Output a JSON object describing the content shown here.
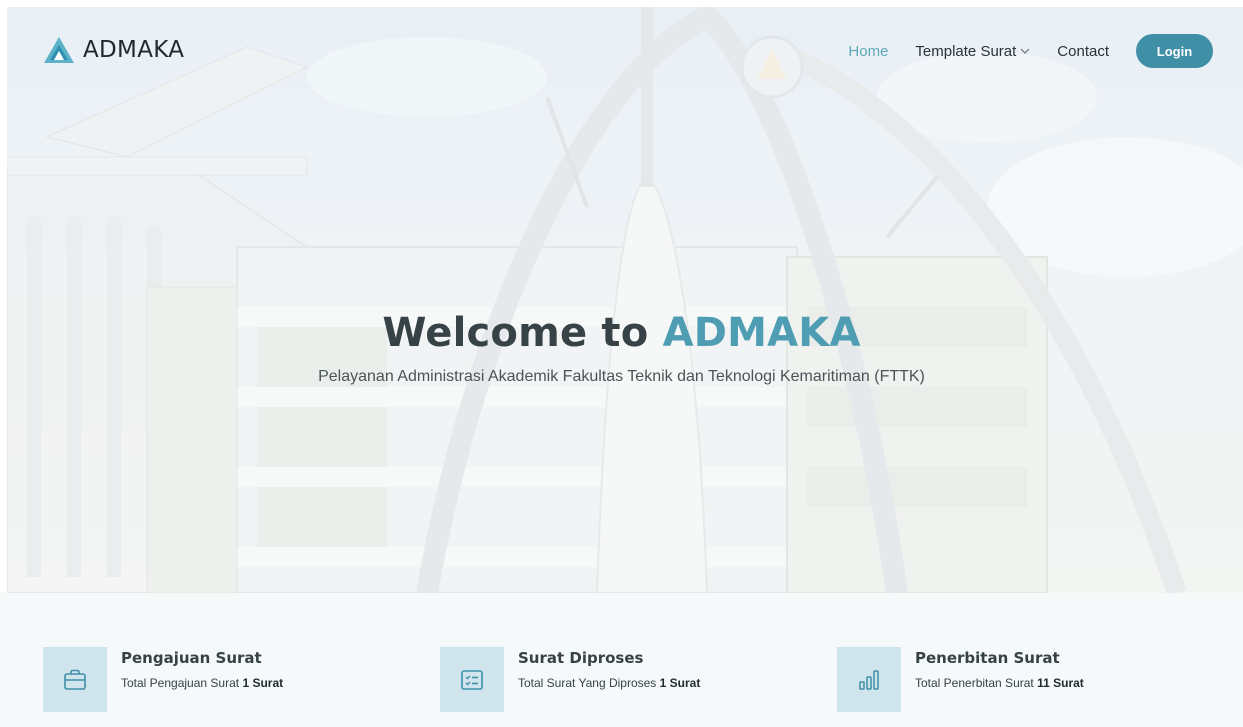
{
  "brand": {
    "name": "ADMAKA",
    "logo_icon": "triangle-logo-icon",
    "accent_color": "#4e9db3",
    "button_color": "#3f8fa7"
  },
  "nav": {
    "items": [
      {
        "label": "Home",
        "active": true
      },
      {
        "label": "Template Surat",
        "has_dropdown": true,
        "icon": "chevron-down-icon"
      },
      {
        "label": "Contact"
      }
    ],
    "login_label": "Login"
  },
  "hero": {
    "title_prefix": "Welcome to",
    "title_accent": "ADMAKA",
    "subtitle": "Pelayanan Administrasi Akademik Fakultas Teknik dan Teknologi Kemaritiman (FTTK)"
  },
  "stats": [
    {
      "icon": "briefcase-icon",
      "title": "Pengajuan Surat",
      "desc": "Total Pengajuan Surat",
      "value": "1 Surat"
    },
    {
      "icon": "checklist-icon",
      "title": "Surat Diproses",
      "desc": "Total Surat Yang Diproses",
      "value": "1 Surat"
    },
    {
      "icon": "bar-chart-icon",
      "title": "Penerbitan Surat",
      "desc": "Total Penerbitan Surat",
      "value": "11 Surat"
    }
  ]
}
